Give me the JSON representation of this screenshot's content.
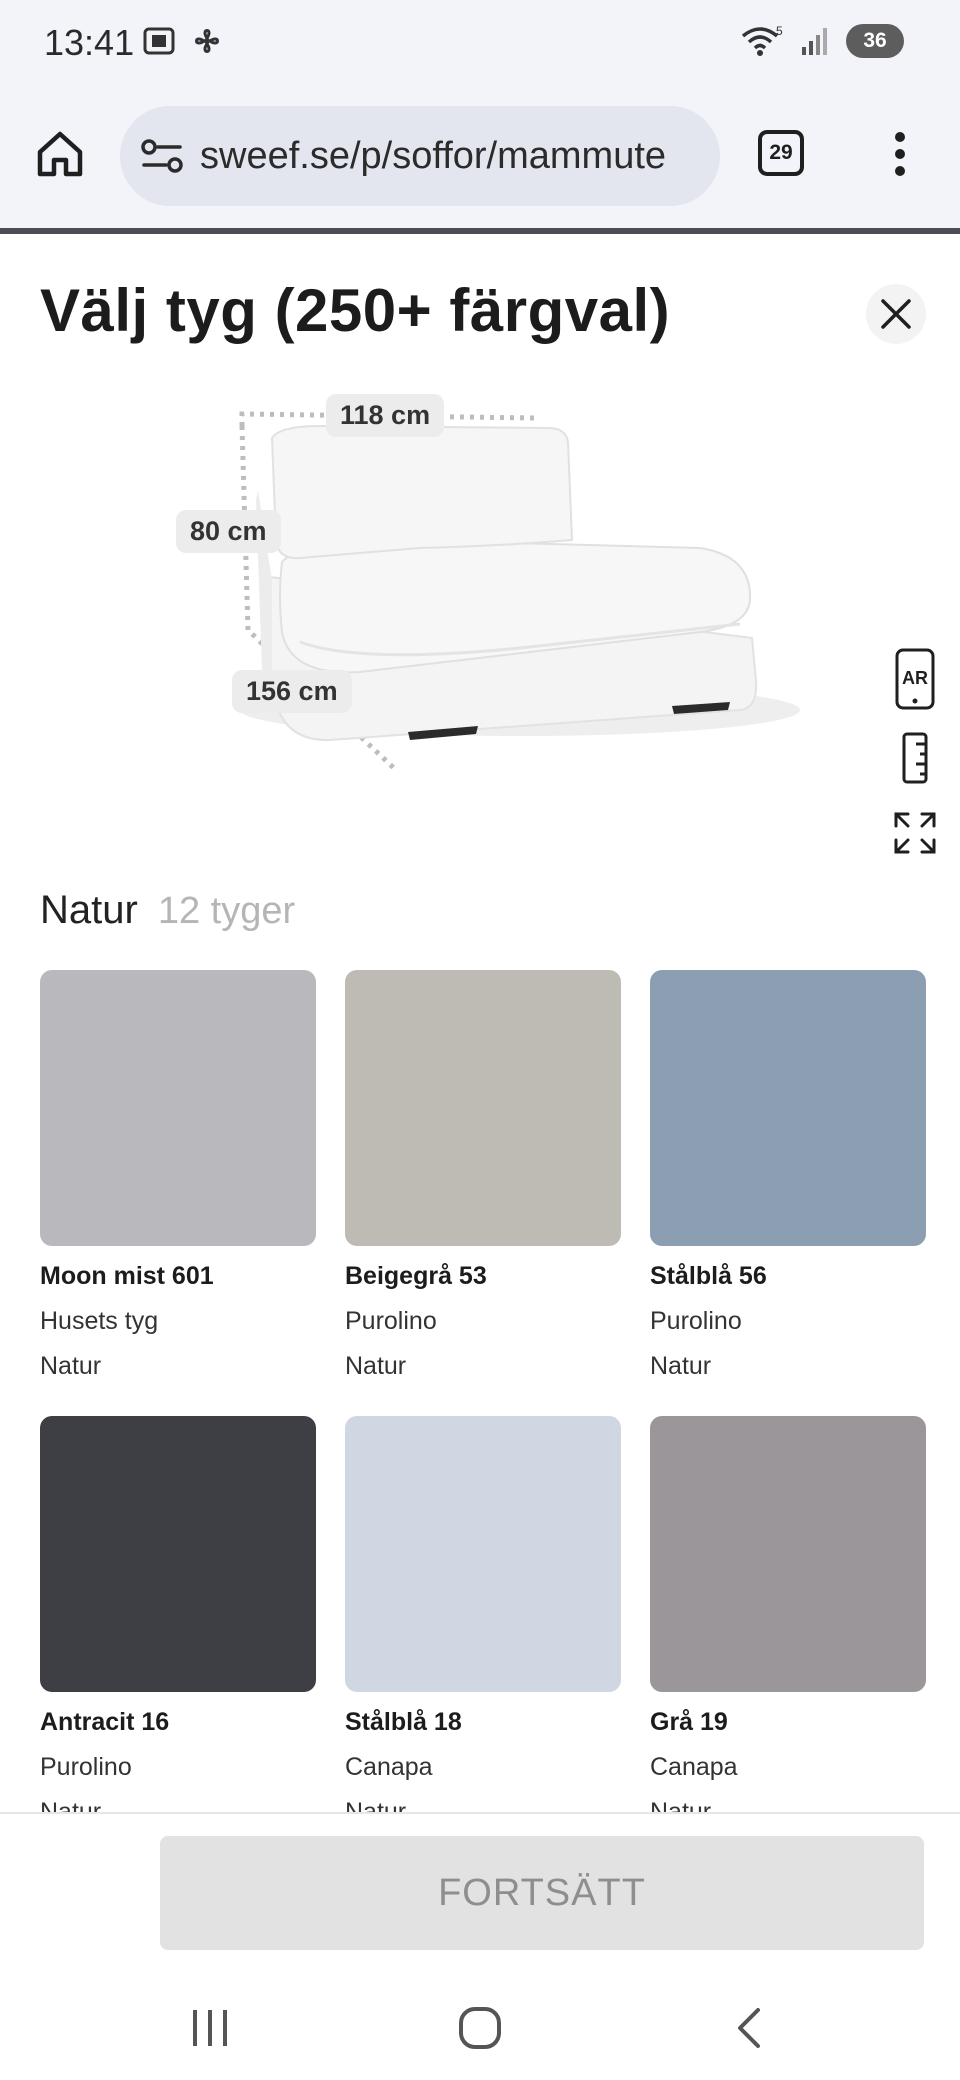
{
  "status": {
    "time": "13:41",
    "battery": "36",
    "wifi_badge": "5"
  },
  "browser": {
    "url": "sweef.se/p/soffor/mammute",
    "tab_count": "29"
  },
  "sheet": {
    "title": "Välj tyg (250+ färgval)"
  },
  "dimensions": {
    "width": "118 cm",
    "height": "80 cm",
    "depth": "156 cm"
  },
  "tools": {
    "ar_label": "AR"
  },
  "section": {
    "title": "Natur",
    "count": "12 tyger"
  },
  "fabrics": [
    {
      "name": "Moon mist 601",
      "fabric": "Husets tyg",
      "category": "Natur",
      "color": "#b9b8bd"
    },
    {
      "name": "Beigegrå 53",
      "fabric": "Purolino",
      "category": "Natur",
      "color": "#bdbbb3"
    },
    {
      "name": "Stålblå 56",
      "fabric": "Purolino",
      "category": "Natur",
      "color": "#8c9fb2"
    },
    {
      "name": "Antracit 16",
      "fabric": "Purolino",
      "category": "Natur",
      "color": "#3d3f45"
    },
    {
      "name": "Stålblå 18",
      "fabric": "Canapa",
      "category": "Natur",
      "color": "#d0d7e2"
    },
    {
      "name": "Grå 19",
      "fabric": "Canapa",
      "category": "Natur",
      "color": "#9b9699"
    }
  ],
  "actions": {
    "continue": "FORTSÄTT"
  }
}
